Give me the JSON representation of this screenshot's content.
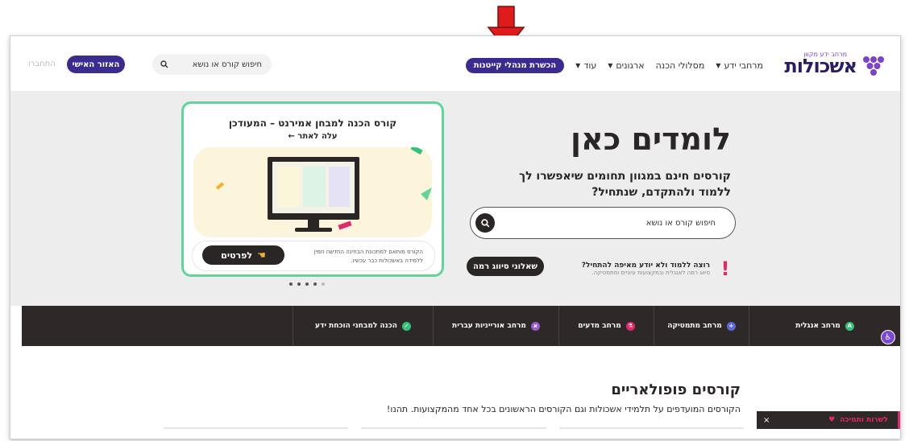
{
  "header": {
    "logo_tagline": "מרחב ידע מקוון",
    "logo_name": "אשכולות",
    "nav": [
      {
        "label": "מרחבי ידע",
        "caret": true
      },
      {
        "label": "מסלולי הכנה",
        "caret": false
      },
      {
        "label": "ארגונים",
        "caret": true
      },
      {
        "label": "עוד",
        "caret": true
      }
    ],
    "promo_pill": "הכשרת מנהלי קייטנות",
    "search_placeholder": "חיפוש קורס או נושא",
    "personal_area": "האזור האישי",
    "login": "התחברו"
  },
  "hero": {
    "title": "לומדים כאן",
    "subtitle": "קורסים חינם במגוון תחומים שיאפשרו לך ללמוד ולהתקדם, שנתחיל?",
    "search_placeholder": "חיפוש קורס או נושא",
    "help_question": "רוצה ללמוד ולא יודע מאיפה להתחיל?",
    "help_desc": "סיווג רמה לאנגלית ובמקצועות עיוניים ומתמטיקה.",
    "level_button": "שאלוני סיווג רמה",
    "card": {
      "title": "קורס הכנה למבחן אמירנט – המעודכן",
      "link": "עלה לאתר ←",
      "desc": "הקורס מותאם למתכונת הבחינה החדשה וזמין ללמידה באשכולות כבר עכשיו.",
      "details_button": "לפרטים"
    },
    "carousel": {
      "total": 5,
      "active": 0
    }
  },
  "categories": [
    {
      "label": "מרחב אנגלית",
      "icon": "english-icon",
      "color": "#34c27a"
    },
    {
      "label": "מרחב מתמטיקה",
      "icon": "math-icon",
      "color": "#5a6ad8"
    },
    {
      "label": "מרחב מדעים",
      "icon": "science-icon",
      "color": "#e2286b"
    },
    {
      "label": "מרחב אורייניות עברית",
      "icon": "hebrew-icon",
      "color": "#9c5ad6"
    },
    {
      "label": "הכנה למבחני הוכחת ידע",
      "icon": "exam-icon",
      "color": "#34c27a"
    }
  ],
  "popular": {
    "title": "קורסים פופולאריים",
    "subtitle": "הקורסים המועדפים על תלמידי אשכולות וגם הקורסים הראשונים בכל אחד מהמקצועות. תהנו!"
  },
  "support": {
    "label": "לשרות ותמיכה",
    "close": "×"
  },
  "colors": {
    "brand": "#3a2b91",
    "accent_green": "#5ed59a",
    "accent_pink": "#e2286b",
    "dark": "#2e2828"
  }
}
